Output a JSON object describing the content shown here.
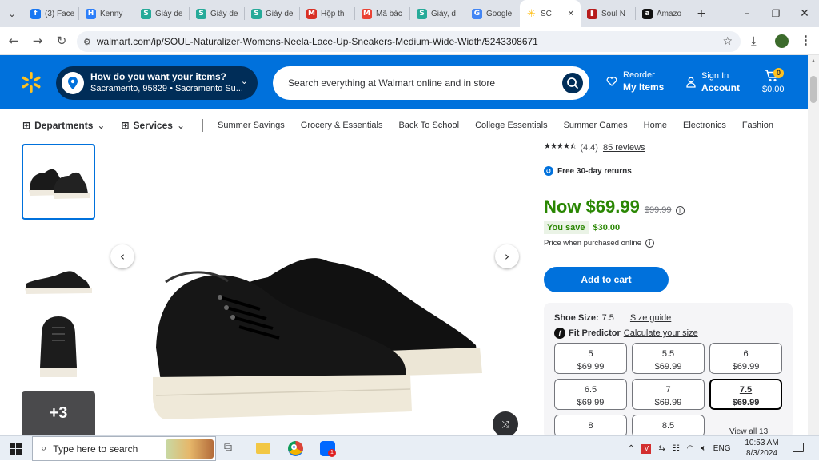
{
  "browser": {
    "tabs": [
      {
        "label": "(3) Face",
        "icon": "facebook-icon",
        "color": "#1877f2",
        "glyph": "f"
      },
      {
        "label": "Kenny",
        "icon": "hubspot-icon",
        "color": "#2d7ff9",
        "glyph": "H"
      },
      {
        "label": "Giày de",
        "icon": "shopee-s-icon",
        "color": "#26aa99",
        "glyph": "S"
      },
      {
        "label": "Giày de",
        "icon": "shopee-s-icon",
        "color": "#26aa99",
        "glyph": "S"
      },
      {
        "label": "Giày de",
        "icon": "shopee-s-icon",
        "color": "#26aa99",
        "glyph": "S"
      },
      {
        "label": "Hộp th",
        "icon": "mail-icon",
        "color": "#d93025",
        "glyph": "M"
      },
      {
        "label": "Mã bác",
        "icon": "gmail-icon",
        "color": "#ea4335",
        "glyph": "M"
      },
      {
        "label": "Giày, d",
        "icon": "shopee-s-icon",
        "color": "#26aa99",
        "glyph": "S"
      },
      {
        "label": "Google",
        "icon": "google-icon",
        "color": "#4285f4",
        "glyph": "G"
      },
      {
        "label": "SC",
        "icon": "walmart-spark-icon",
        "color": "#ffc220",
        "glyph": "✳",
        "active": true
      },
      {
        "label": "Soul N",
        "icon": "soul-icon",
        "color": "#b71c1c",
        "glyph": "▮"
      },
      {
        "label": "Amazo",
        "icon": "amazon-icon",
        "color": "#111111",
        "glyph": "a"
      }
    ],
    "close_tab": "✕",
    "new_tab": "+",
    "url": "walmart.com/ip/SOUL-Naturalizer-Womens-Neela-Lace-Up-Sneakers-Medium-Wide-Width/5243308671"
  },
  "header": {
    "location_title": "How do you want your items?",
    "location_sub": "Sacramento, 95829 • Sacramento Su...",
    "search_placeholder": "Search everything at Walmart online and in store",
    "reorder_line1": "Reorder",
    "reorder_line2": "My Items",
    "signin_line1": "Sign In",
    "signin_line2": "Account",
    "cart_count": "0",
    "cart_total": "$0.00"
  },
  "subnav": {
    "departments": "Departments",
    "services": "Services",
    "categories": [
      "Summer Savings",
      "Grocery & Essentials",
      "Back To School",
      "College Essentials",
      "Summer Games",
      "Home",
      "Electronics",
      "Fashion"
    ]
  },
  "gallery": {
    "more_label": "+3"
  },
  "product": {
    "rating_text": "(4.4)",
    "reviews_link": "85 reviews",
    "rating_value": 4.4,
    "returns": "Free 30-day returns",
    "price_now": "Now $69.99",
    "price_was": "$99.99",
    "you_save_label": "You save",
    "you_save_amount": "$30.00",
    "price_note": "Price when purchased online",
    "add_to_cart": "Add to cart",
    "shoe_size_label": "Shoe Size:",
    "shoe_size_value": "7.5",
    "size_guide": "Size guide",
    "fit_label": "Fit Predictor",
    "fit_link": "Calculate your size",
    "sizes": [
      {
        "size": "5",
        "price": "$69.99"
      },
      {
        "size": "5.5",
        "price": "$69.99"
      },
      {
        "size": "6",
        "price": "$69.99"
      },
      {
        "size": "6.5",
        "price": "$69.99"
      },
      {
        "size": "7",
        "price": "$69.99"
      },
      {
        "size": "7.5",
        "price": "$69.99",
        "selected": true
      },
      {
        "size": "8",
        "price": ""
      },
      {
        "size": "8.5",
        "price": ""
      }
    ],
    "view_all": "View all 13"
  },
  "colors": {
    "walmart_blue": "#0071dc",
    "walmart_dark": "#002d58",
    "spark_yellow": "#ffc220",
    "price_green": "#2a8703"
  },
  "taskbar": {
    "search_placeholder": "Type here to search",
    "language": "ENG",
    "time": "10:53 AM",
    "date": "8/3/2024"
  }
}
